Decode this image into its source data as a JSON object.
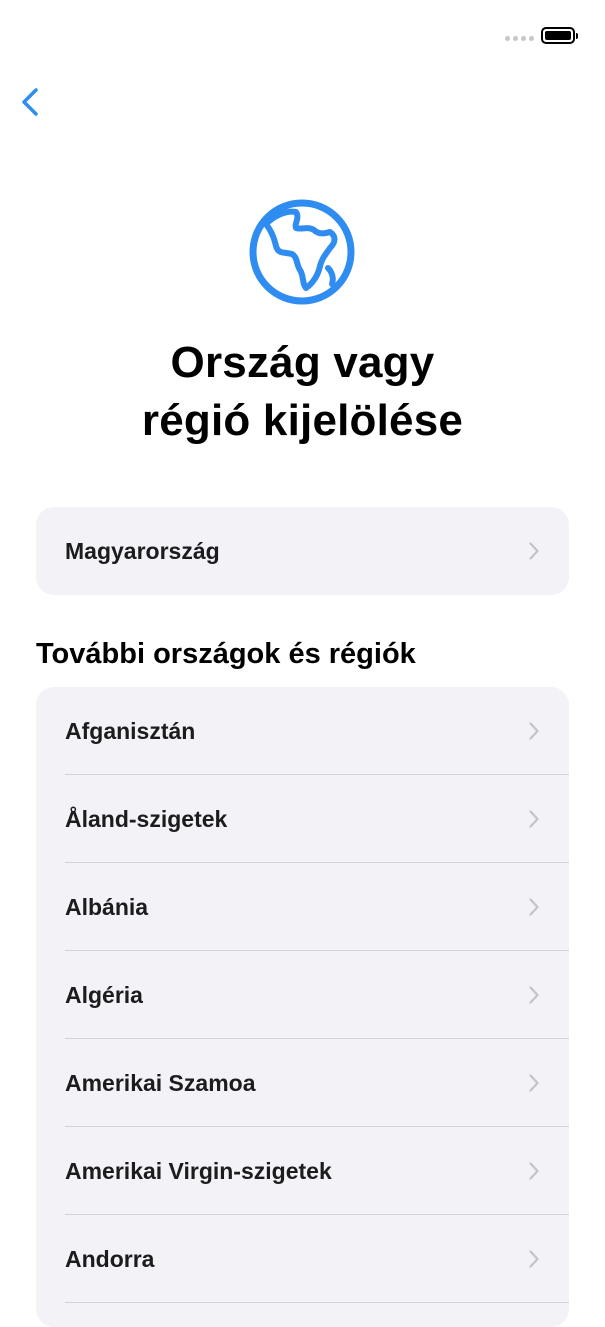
{
  "status_bar": {
    "signal_icon": "signal-dots-icon",
    "battery_icon": "battery-full-icon"
  },
  "nav": {
    "back_icon": "chevron-left-icon",
    "accent_color": "#2f8cf0"
  },
  "header": {
    "icon": "globe-icon",
    "title_line1": "Ország vagy",
    "title_line2": "régió kijelölése"
  },
  "suggested": {
    "label": "Magyarország"
  },
  "section": {
    "heading": "További országok és régiók"
  },
  "countries": [
    {
      "label": "Afganisztán"
    },
    {
      "label": "Åland-szigetek"
    },
    {
      "label": "Albánia"
    },
    {
      "label": "Algéria"
    },
    {
      "label": "Amerikai Szamoa"
    },
    {
      "label": "Amerikai Virgin-szigetek"
    },
    {
      "label": "Andorra"
    }
  ]
}
